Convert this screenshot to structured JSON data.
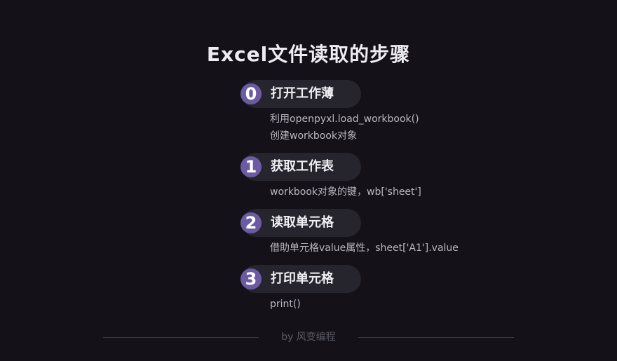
{
  "title": "Excel文件读取的步骤",
  "steps": [
    {
      "number": "0",
      "title": "打开工作薄",
      "desc": [
        "利用openpyxl.load_workbook()",
        "创建workbook对象"
      ]
    },
    {
      "number": "1",
      "title": "获取工作表",
      "desc": [
        "workbook对象的键，wb['sheet']"
      ]
    },
    {
      "number": "2",
      "title": "读取单元格",
      "desc": [
        "借助单元格value属性，sheet['A1'].value"
      ]
    },
    {
      "number": "3",
      "title": "打印单元格",
      "desc": [
        "print()"
      ]
    }
  ],
  "footer": "by 风变编程",
  "colors": {
    "background": "#141218",
    "badge": "#6c5ba2",
    "pill": "#26242c"
  }
}
